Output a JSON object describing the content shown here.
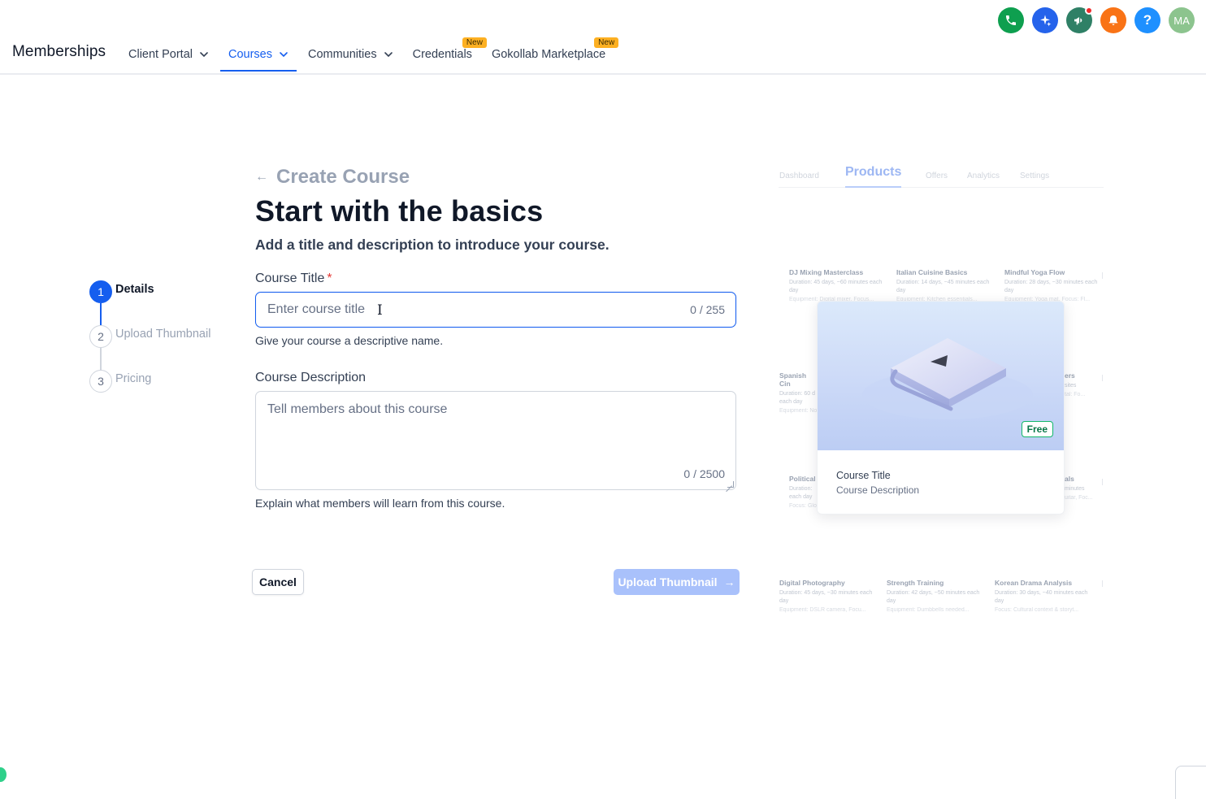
{
  "header": {
    "brand": "Memberships",
    "nav": [
      {
        "label": "Client Portal"
      },
      {
        "label": "Courses"
      },
      {
        "label": "Communities"
      },
      {
        "label": "Credentials",
        "badge": "New"
      },
      {
        "label": "Gokollab Marketplace",
        "badge": "New"
      }
    ],
    "avatar_initials": "MA",
    "help_glyph": "?",
    "icons": [
      "phone-icon",
      "sparkle-icon",
      "megaphone-icon",
      "bell-icon",
      "help-icon",
      "avatar"
    ]
  },
  "stepper": {
    "steps": [
      {
        "num": "1",
        "label": "Details"
      },
      {
        "num": "2",
        "label": "Upload Thumbnail"
      },
      {
        "num": "3",
        "label": "Pricing"
      }
    ]
  },
  "form": {
    "back_label": "Create Course",
    "heading": "Start with the basics",
    "subheading": "Add a title and description to introduce your course.",
    "title_label": "Course Title",
    "required_mark": "*",
    "title_placeholder": "Enter course title",
    "title_count": "0 / 255",
    "title_hint": "Give your course a descriptive name.",
    "desc_label": "Course Description",
    "desc_placeholder": "Tell members about this course",
    "desc_count": "0 / 2500",
    "desc_hint": "Explain what members will learn from this course."
  },
  "actions": {
    "cancel": "Cancel",
    "next": "Upload Thumbnail"
  },
  "preview": {
    "tabs": [
      "Dashboard",
      "Products",
      "Offers",
      "Analytics",
      "Settings"
    ],
    "products": [
      {
        "title": "DJ Mixing Masterclass",
        "desc": "Duration: 45 days, ~60 minutes each day",
        "extra": "Equipment: Digital mixer, Focus..."
      },
      {
        "title": "Italian Cuisine Basics",
        "desc": "Duration: 14 days, ~45 minutes each day",
        "extra": "Equipment: Kitchen essentials..."
      },
      {
        "title": "Mindful Yoga Flow",
        "desc": "Duration: 28 days, ~30 minutes each day",
        "extra": "Equipment: Yoga mat, Focus: Fl..."
      },
      {
        "title": "Spanish Cin",
        "desc": "Duration: 60 d each day",
        "extra": "Equipment: No"
      },
      {
        "title": "ers",
        "desc": "sites",
        "extra": "tal: Fo..."
      },
      {
        "title": "Political",
        "desc": "Duration: each day",
        "extra": "Focus: Glo"
      },
      {
        "title": "als",
        "desc": "minutes",
        "extra": "uitar, Foc..."
      },
      {
        "title": "Digital Photography",
        "desc": "Duration: 45 days, ~30 minutes each day",
        "extra": "Equipment: DSLR camera, Focu..."
      },
      {
        "title": "Strength Training",
        "desc": "Duration: 42 days, ~50 minutes each day",
        "extra": "Equipment: Dumbbells needed..."
      },
      {
        "title": "Korean Drama Analysis",
        "desc": "Duration: 30 days, ~40 minutes each day",
        "extra": "Focus: Cultural context & storyt..."
      }
    ],
    "card": {
      "badge": "Free",
      "title": "Course Title",
      "description": "Course Description"
    }
  },
  "colors": {
    "accent": "#155eef",
    "disabled_button": "#a9c1fb",
    "free_badge": "#12b76a",
    "new_badge": "#fdb022"
  }
}
